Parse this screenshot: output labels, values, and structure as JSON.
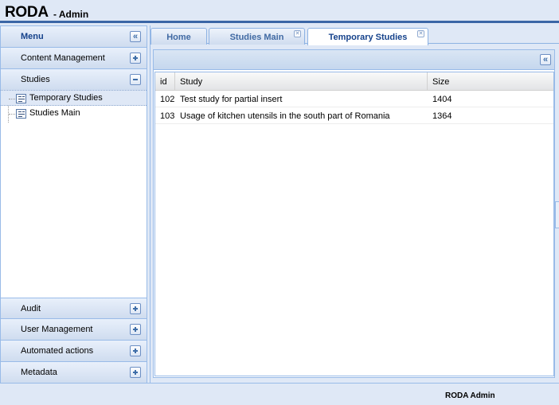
{
  "header": {
    "title": "RODA",
    "subtitle": "- Admin"
  },
  "menu": {
    "title": "Menu",
    "sections_top": [
      {
        "label": "Content Management",
        "state": "collapsed"
      },
      {
        "label": "Studies",
        "state": "expanded"
      }
    ],
    "tree": [
      {
        "label": "Temporary Studies",
        "selected": true
      },
      {
        "label": "Studies Main",
        "selected": false
      }
    ],
    "sections_bottom": [
      {
        "label": "Audit"
      },
      {
        "label": "User Management"
      },
      {
        "label": "Automated actions"
      },
      {
        "label": "Metadata"
      }
    ]
  },
  "tabs": [
    {
      "label": "Home",
      "closable": false,
      "active": false
    },
    {
      "label": "Studies Main",
      "closable": true,
      "active": false
    },
    {
      "label": "Temporary Studies",
      "closable": true,
      "active": true
    }
  ],
  "grid": {
    "columns": [
      "id",
      "Study",
      "Size"
    ],
    "rows": [
      {
        "id": "102",
        "study": "Test study for partial insert",
        "size": "1404"
      },
      {
        "id": "103",
        "study": "Usage of kitchen utensils in the south part of Romania",
        "size": "1364"
      }
    ]
  },
  "footer": {
    "text": "RODA Admin"
  },
  "colors": {
    "accent": "#15428b",
    "border": "#99bbe8",
    "background": "#dfe8f6"
  }
}
